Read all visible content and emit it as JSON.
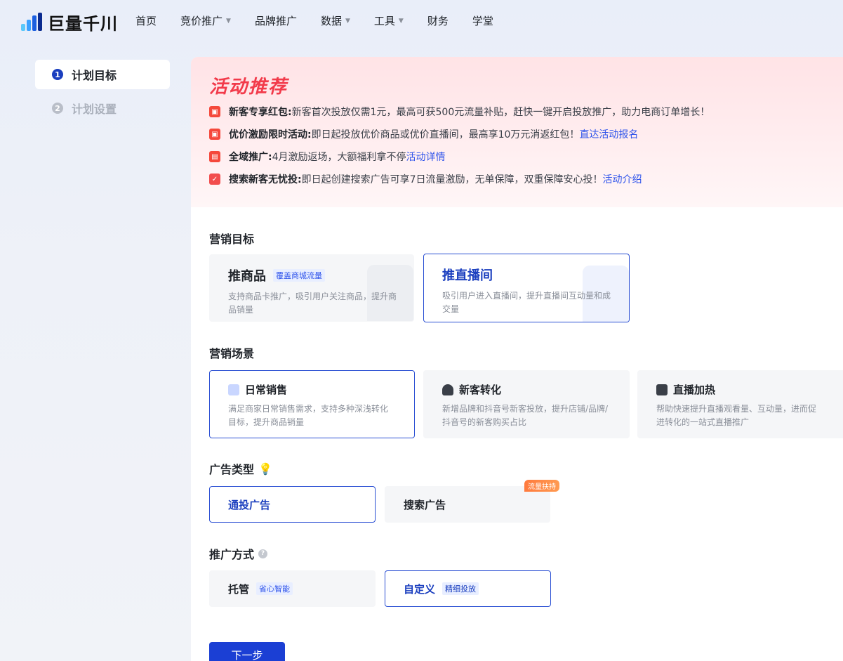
{
  "app": {
    "logo_text": "巨量千川"
  },
  "nav": {
    "items": [
      {
        "label": "首页",
        "has_caret": false
      },
      {
        "label": "竞价推广",
        "has_caret": true
      },
      {
        "label": "品牌推广",
        "has_caret": false
      },
      {
        "label": "数据",
        "has_caret": true
      },
      {
        "label": "工具",
        "has_caret": true
      },
      {
        "label": "财务",
        "has_caret": false
      },
      {
        "label": "学堂",
        "has_caret": false
      }
    ]
  },
  "steps": [
    {
      "num": "1",
      "label": "计划目标",
      "active": true
    },
    {
      "num": "2",
      "label": "计划设置",
      "active": false
    }
  ],
  "promo": {
    "title": "活动推荐",
    "rows": [
      {
        "bold": "新客专享红包:",
        "text": " 新客首次投放仅需1元，最高可获500元流量补贴，赶快一键开启投放推广，助力电商订单增长！",
        "link": ""
      },
      {
        "bold": "优价激励限时活动:",
        "text": " 即日起投放优价商品或优价直播间，最高享10万元消返红包！",
        "link": "直达活动报名"
      },
      {
        "bold": "全域推广:",
        "text": " 4月激励返场，大额福利拿不停",
        "link": "活动详情"
      },
      {
        "bold": "搜索新客无忧投:",
        "text": " 即日起创建搜索广告可享7日流量激励，无单保障，双重保障安心投！",
        "link": "活动介绍"
      }
    ]
  },
  "marketing_goal": {
    "title": "营销目标",
    "options": [
      {
        "title": "推商品",
        "tag": "覆盖商城流量",
        "desc": "支持商品卡推广，吸引用户关注商品，提升商品销量",
        "selected": false
      },
      {
        "title": "推直播间",
        "tag": "",
        "desc": "吸引用户进入直播间，提升直播间互动量和成交量",
        "selected": true
      }
    ]
  },
  "marketing_scene": {
    "title": "营销场景",
    "options": [
      {
        "title": "日常销售",
        "desc": "满足商家日常销售需求，支持多种深浅转化目标，提升商品销量",
        "selected": true
      },
      {
        "title": "新客转化",
        "desc": "新增品牌和抖音号新客投放，提升店铺/品牌/抖音号的新客购买占比",
        "selected": false
      },
      {
        "title": "直播加热",
        "desc": "帮助快速提升直播观看量、互动量，进而促进转化的一站式直播推广",
        "selected": false
      }
    ]
  },
  "ad_type": {
    "title": "广告类型",
    "options": [
      {
        "label": "通投广告",
        "badge": "",
        "selected": true
      },
      {
        "label": "搜索广告",
        "badge": "流量扶持",
        "selected": false
      }
    ]
  },
  "promo_method": {
    "title": "推广方式",
    "options": [
      {
        "label": "托管",
        "tag": "省心智能",
        "selected": false
      },
      {
        "label": "自定义",
        "tag": "精细投放",
        "selected": true
      }
    ]
  },
  "next_button": "下一步",
  "colors": {
    "primary": "#1b3fd4",
    "promo_red": "#f23a4a",
    "link": "#2f54eb"
  }
}
